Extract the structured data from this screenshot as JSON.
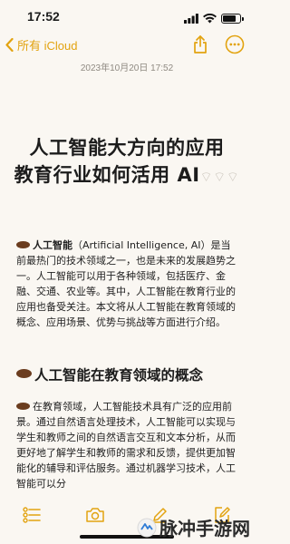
{
  "status_bar": {
    "time": "17:52",
    "battery_level": 0.8
  },
  "nav": {
    "back_label": "所有 iCloud",
    "actions": [
      "share-icon",
      "more-icon"
    ]
  },
  "note": {
    "timestamp": "2023年10月20日 17:52",
    "title_line1": "人工智能大方向的应用",
    "title_line2": "教育行业如何活用 AI",
    "title_faded": "⌔⌔⌔",
    "intro_lead": "人工智能",
    "intro_rest": "（Artificial Intelligence, AI）是当前最热门的技术领域之一，也是未来的发展趋势之一。人工智能可以用于各种领域，包括医疗、金融、交通、农业等。其中，人工智能在教育行业的应用也备受关注。本文将从人工智能在教育领域的概念、应用场景、优势与挑战等方面进行介绍。",
    "section1_heading": "人工智能在教育领域的概念",
    "section1_body": "在教育领域，人工智能技术具有广泛的应用前景。通过自然语言处理技术，人工智能可以实现与学生和教师之间的自然语言交互和文本分析，从而更好地了解学生和教师的需求和反馈，提供更加智能化的辅导和评估服务。通过机器学习技术，人工智能可以分"
  },
  "toolbar": {
    "items": [
      "checklist-icon",
      "camera-icon",
      "pen-icon",
      "compose-icon"
    ]
  },
  "watermark": {
    "text": "脉冲手游网"
  }
}
